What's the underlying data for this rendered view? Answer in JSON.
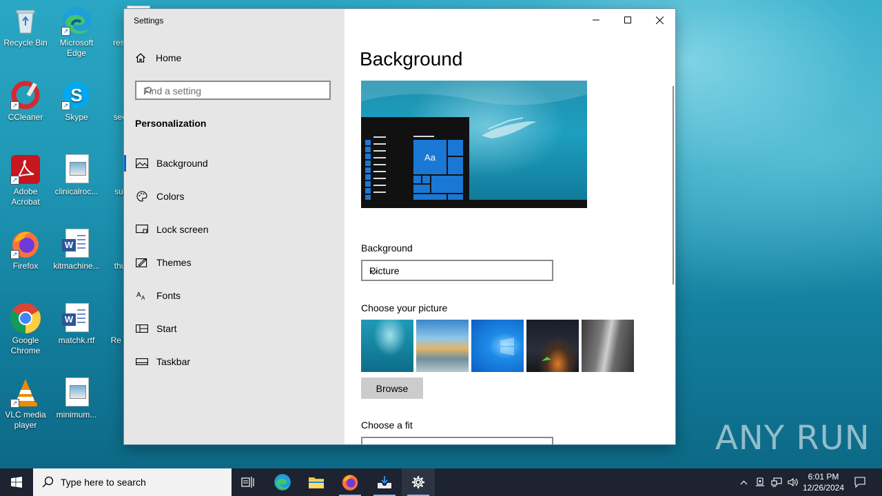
{
  "desktop": {
    "icons": [
      {
        "label": "Recycle Bin"
      },
      {
        "label": "Microsoft Edge"
      },
      {
        "label": "respe..."
      },
      {
        "label": "CCleaner"
      },
      {
        "label": "Skype"
      },
      {
        "label": "secur..."
      },
      {
        "label": "Adobe Acrobat"
      },
      {
        "label": "clinicalroc..."
      },
      {
        "label": "supp..."
      },
      {
        "label": "Firefox"
      },
      {
        "label": "kitmachine..."
      },
      {
        "label": "thurs..."
      },
      {
        "label": "Google Chrome"
      },
      {
        "label": "matchk.rtf"
      },
      {
        "label": "Re Lau..."
      },
      {
        "label": "VLC media player"
      },
      {
        "label": "minimum..."
      }
    ]
  },
  "window": {
    "title": "Settings",
    "nav": {
      "home": "Home",
      "search_placeholder": "Find a setting",
      "section": "Personalization",
      "items": [
        {
          "label": "Background",
          "icon": "picture-icon",
          "active": true
        },
        {
          "label": "Colors",
          "icon": "palette-icon",
          "active": false
        },
        {
          "label": "Lock screen",
          "icon": "lock-screen-icon",
          "active": false
        },
        {
          "label": "Themes",
          "icon": "themes-icon",
          "active": false
        },
        {
          "label": "Fonts",
          "icon": "fonts-icon",
          "active": false
        },
        {
          "label": "Start",
          "icon": "start-icon",
          "active": false
        },
        {
          "label": "Taskbar",
          "icon": "taskbar-icon",
          "active": false
        }
      ]
    },
    "main": {
      "title": "Background",
      "preview_tile_text": "Aa",
      "background_label": "Background",
      "background_value": "Picture",
      "choose_picture_label": "Choose your picture",
      "browse_label": "Browse",
      "choose_fit_label": "Choose a fit"
    }
  },
  "taskbar": {
    "search_placeholder": "Type here to search",
    "time": "6:01 PM",
    "date": "12/26/2024"
  },
  "watermark": "ANY RUN",
  "colors": {
    "accent": "#0067c0",
    "tile_blue": "#1a78d4",
    "taskbar_bg": "#1d2330",
    "nav_bg": "#e6e6e6"
  }
}
